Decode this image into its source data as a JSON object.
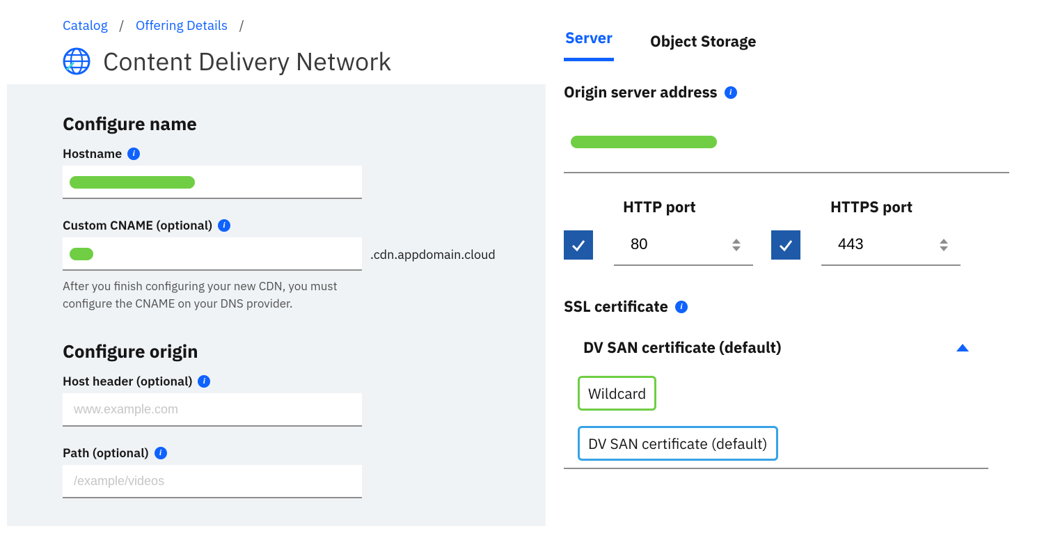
{
  "breadcrumbs": {
    "catalog": "Catalog",
    "offering": "Offering Details"
  },
  "page_title": "Content Delivery Network",
  "left": {
    "section_name": "Configure name",
    "hostname_label": "Hostname",
    "cname_label": "Custom CNAME (optional)",
    "cname_suffix": ".cdn.appdomain.cloud",
    "cname_helper": "After you finish configuring your new CDN, you must configure the CNAME on your DNS provider.",
    "section_origin": "Configure origin",
    "hostheader_label": "Host header (optional)",
    "hostheader_placeholder": "www.example.com",
    "path_label": "Path (optional)",
    "path_placeholder": "/example/videos"
  },
  "right": {
    "tabs": {
      "server": "Server",
      "object": "Object Storage"
    },
    "origin_label": "Origin server address",
    "http_label": "HTTP port",
    "http_value": "80",
    "https_label": "HTTPS port",
    "https_value": "443",
    "ssl_label": "SSL certificate",
    "ssl_selected": "DV SAN certificate (default)",
    "ssl_opt_wildcard": "Wildcard",
    "ssl_opt_dvsan": "DV SAN certificate (default)"
  }
}
